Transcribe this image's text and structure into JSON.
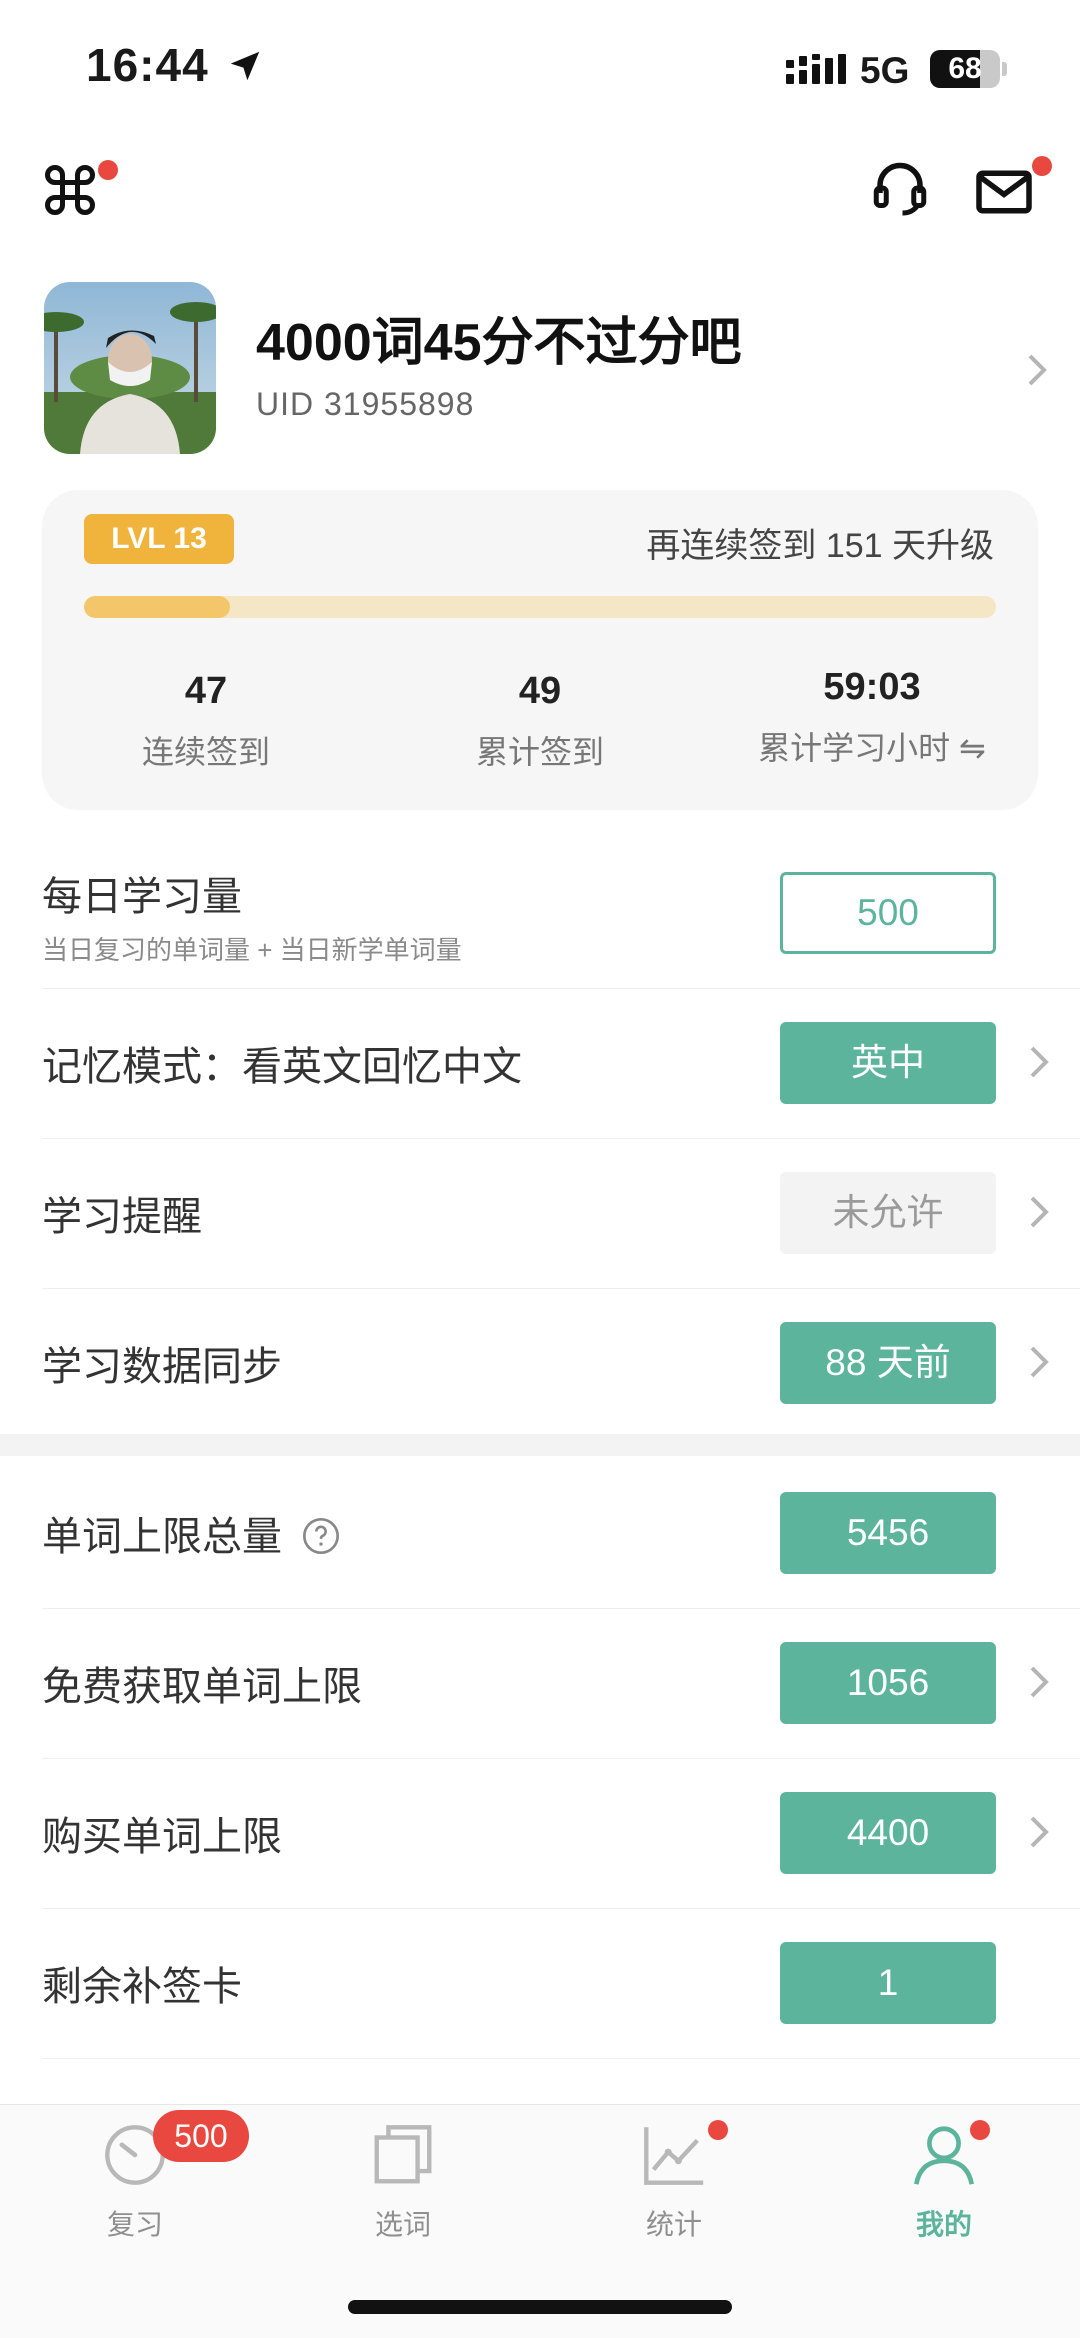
{
  "status_bar": {
    "time": "16:44",
    "network": "5G",
    "battery": "68"
  },
  "profile": {
    "nickname": "4000词45分不过分吧",
    "uid": "UID 31955898"
  },
  "level": {
    "badge": "LVL 13",
    "note": "再连续签到 151 天升级",
    "progress_fraction": 0.16,
    "stats": [
      {
        "value": "47",
        "label": "连续签到"
      },
      {
        "value": "49",
        "label": "累计签到"
      },
      {
        "value": "59:03",
        "label": "累计学习小时 ⇋"
      }
    ]
  },
  "settings": {
    "daily": {
      "label": "每日学习量",
      "sub": "当日复习的单词量 + 当日新学单词量",
      "value": "500"
    },
    "memory_mode": {
      "label": "记忆模式：看英文回忆中文",
      "value": "英中"
    },
    "reminder": {
      "label": "学习提醒",
      "value": "未允许"
    },
    "sync": {
      "label": "学习数据同步",
      "value": "88 天前"
    },
    "word_limit_total": {
      "label": "单词上限总量",
      "value": "5456"
    },
    "free_limit": {
      "label": "免费获取单词上限",
      "value": "1056"
    },
    "buy_limit": {
      "label": "购买单词上限",
      "value": "4400"
    },
    "makeup_cards": {
      "label": "剩余补签卡",
      "value": "1"
    }
  },
  "tabs": {
    "review": {
      "label": "复习",
      "badge": "500"
    },
    "select": {
      "label": "选词"
    },
    "stats": {
      "label": "统计"
    },
    "me": {
      "label": "我的"
    }
  },
  "colors": {
    "accent": "#5bb49b",
    "level_badge": "#f0b33b",
    "notification": "#e8483f"
  }
}
